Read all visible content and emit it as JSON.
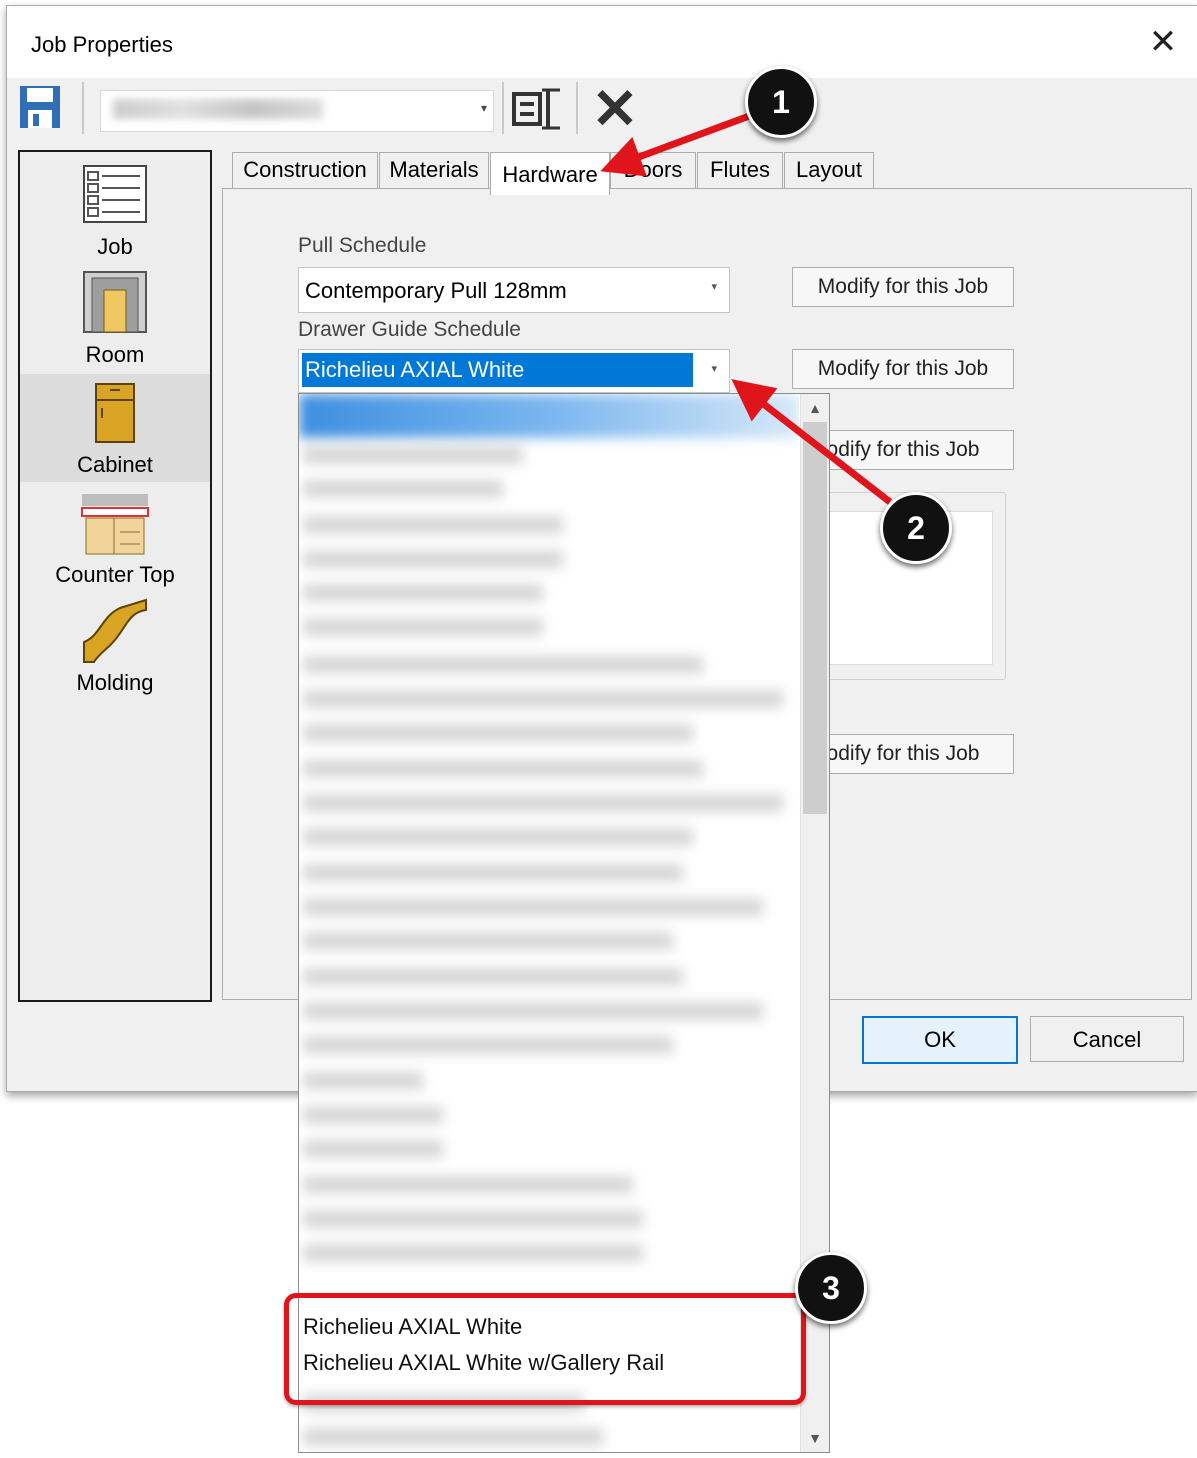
{
  "window": {
    "title": "Job Properties",
    "close_symbol": "✕"
  },
  "toolbar": {
    "save_icon": "save-icon",
    "properties_icon": "properties-icon",
    "delete_symbol": "✕",
    "combo_arrow": "▾"
  },
  "sidebar": {
    "items": [
      {
        "label": "Job",
        "icon": "job-icon"
      },
      {
        "label": "Room",
        "icon": "room-icon"
      },
      {
        "label": "Cabinet",
        "icon": "cabinet-icon",
        "selected": true
      },
      {
        "label": "Counter Top",
        "icon": "countertop-icon"
      },
      {
        "label": "Molding",
        "icon": "molding-icon"
      }
    ]
  },
  "tabs": [
    {
      "label": "Construction"
    },
    {
      "label": "Materials"
    },
    {
      "label": "Hardware",
      "active": true
    },
    {
      "label": "Doors"
    },
    {
      "label": "Flutes"
    },
    {
      "label": "Layout"
    }
  ],
  "hardware": {
    "pull_schedule_label": "Pull Schedule",
    "pull_schedule_value": "Contemporary Pull 128mm",
    "drawer_guide_label": "Drawer Guide Schedule",
    "drawer_guide_value": "Richelieu AXIAL White",
    "modify_label_1": "Modify for this Job",
    "modify_label_2": "Modify for this Job",
    "modify_label_3": "odify for this Job",
    "modify_label_4": "odify for this Job",
    "arrow_glyph": "▾"
  },
  "dropdown": {
    "visible_items": [
      "Richelieu AXIAL White",
      "Richelieu AXIAL White w/Gallery Rail"
    ],
    "scroll_up": "▲",
    "scroll_down": "▼"
  },
  "footer": {
    "ok_label": "OK",
    "cancel_label": "Cancel"
  },
  "annotations": {
    "badge_1": "1",
    "badge_2": "2",
    "badge_3": "3",
    "color": "#e0151b"
  }
}
